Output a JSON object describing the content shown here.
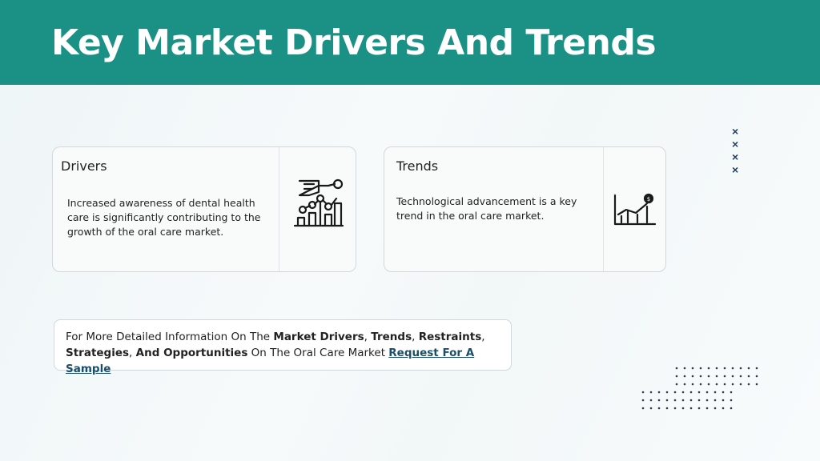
{
  "title": "Key Market Drivers And Trends",
  "drivers": {
    "heading": "Drivers",
    "text": "Increased awareness of dental health care is significantly contributing to the growth of the oral care market.",
    "icon": "growth-chart-hand-icon"
  },
  "trends": {
    "heading": "Trends",
    "text": "Technological advancement is a key trend in the oral care market.",
    "icon": "dollar-chart-icon"
  },
  "info": {
    "t1": "For More Detailed Information On The ",
    "b1": "Market Drivers",
    "sep1": ", ",
    "b2": "Trends",
    "sep2": ", ",
    "b3": "Restraints",
    "sep3": ",",
    "b4": "Strategies",
    "sep4": ", ",
    "b5": "And Opportunities",
    "t2": " On The Oral Care Market ",
    "link": "Request For A Sample"
  },
  "decor": {
    "x_marks": [
      "×",
      "×",
      "×",
      "×"
    ],
    "accent": "#1b9186",
    "navy": "#1f3f66"
  }
}
